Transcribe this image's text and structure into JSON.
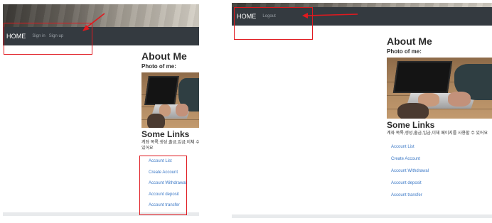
{
  "left": {
    "nav": {
      "brand": "HOME",
      "links": [
        "Sign in",
        "Sign up"
      ]
    },
    "about_title": "About Me",
    "photo_label": "Photo of me:",
    "links_title": "Some Links",
    "description": "계좌 목록,생성,출금,입금,이체 수 있어요",
    "account_links": [
      "Account List",
      "Create Account",
      "Account Withdrawal",
      "Account deposit",
      "Account transfer"
    ]
  },
  "right": {
    "nav": {
      "brand": "HOME",
      "links": [
        "Logout"
      ]
    },
    "about_title": "About Me",
    "photo_label": "Photo of me:",
    "links_title": "Some Links",
    "description": "계좌 목록,생성,출금,입금,이체 페이지를 사용할 수 있어요",
    "account_links": [
      "Account List",
      "Create Account",
      "Account Withdrawal",
      "Account deposit",
      "Account transfer"
    ]
  },
  "colors": {
    "navbar": "#343a40",
    "link": "#3b78c6",
    "highlight": "#e0191f",
    "footer": "#e8eaec"
  },
  "icons": [
    "red-annotation-arrow"
  ]
}
